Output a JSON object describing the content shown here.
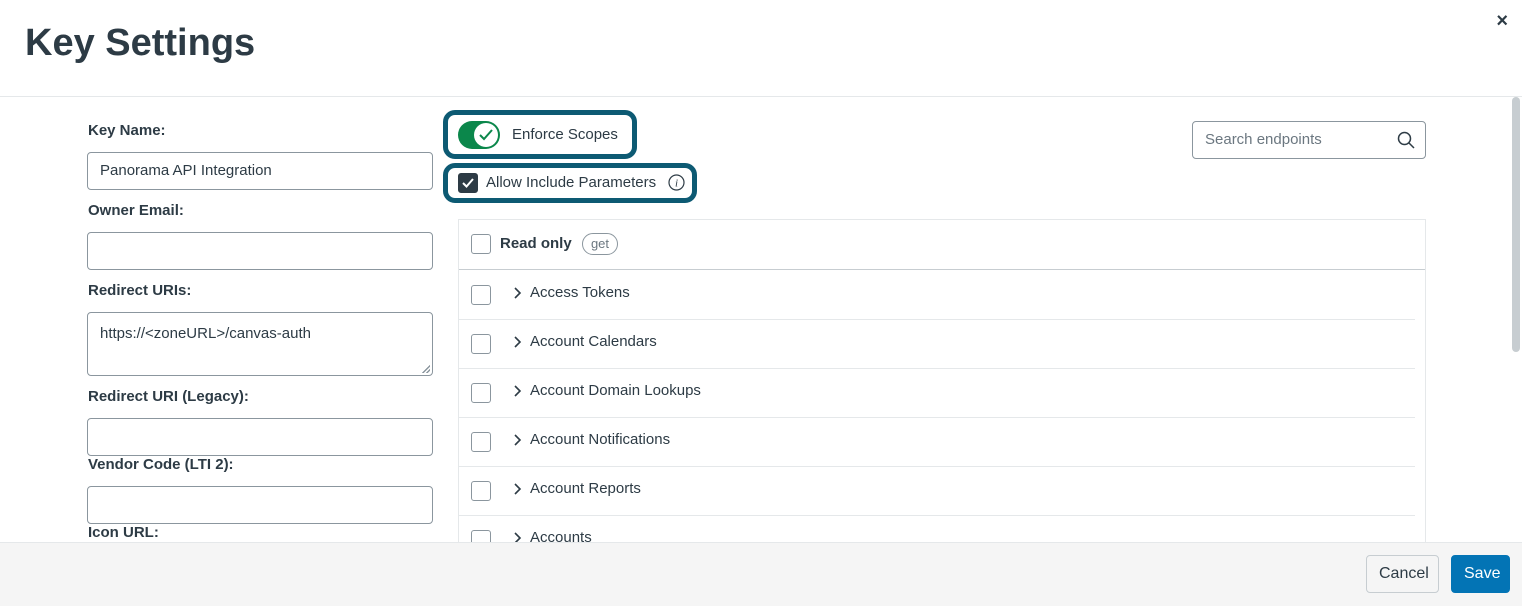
{
  "dialog": {
    "title": "Key Settings",
    "close_label": "×"
  },
  "form": {
    "key_name_label": "Key Name:",
    "key_name_value": "Panorama API Integration",
    "owner_email_label": "Owner Email:",
    "owner_email_value": "",
    "redirect_uris_label": "Redirect URIs:",
    "redirect_uris_value": "https://<zoneURL>/canvas-auth",
    "redirect_uri_legacy_label": "Redirect URI (Legacy):",
    "redirect_uri_legacy_value": "",
    "vendor_code_label": "Vendor Code (LTI 2):",
    "vendor_code_value": "",
    "icon_url_label": "Icon URL:"
  },
  "scopes": {
    "enforce_label": "Enforce Scopes",
    "enforce_on": true,
    "allow_include_label": "Allow Include Parameters",
    "allow_include_checked": true,
    "info_icon": "i",
    "search_placeholder": "Search endpoints",
    "read_only_label": "Read only",
    "read_only_badge": "get",
    "groups": [
      {
        "label": "Access Tokens"
      },
      {
        "label": "Account Calendars"
      },
      {
        "label": "Account Domain Lookups"
      },
      {
        "label": "Account Notifications"
      },
      {
        "label": "Account Reports"
      },
      {
        "label": "Accounts"
      }
    ]
  },
  "footer": {
    "cancel_label": "Cancel",
    "save_label": "Save"
  },
  "colors": {
    "accent": "#0374b5",
    "toggle_on": "#0b874b",
    "highlight": "#0d5a73",
    "text": "#2d3b45"
  }
}
